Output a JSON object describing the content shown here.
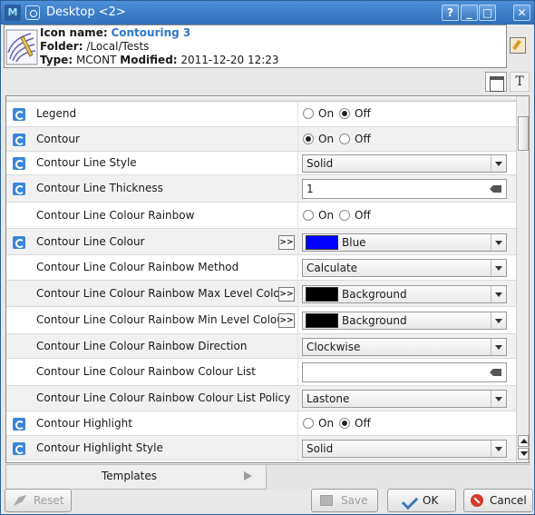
{
  "window": {
    "app_icon": "metview-icon",
    "title": "Desktop <2>",
    "controls": [
      "help-icon",
      "minimize-icon",
      "maximize-icon",
      "close-icon"
    ],
    "help_glyph": "?",
    "min_glyph": "_",
    "max_glyph": "□",
    "close_glyph": "✕"
  },
  "icon_info": {
    "name_label": "Icon name:",
    "name": "Contouring 3",
    "folder_label": "Folder:",
    "folder": "/Local/Tests",
    "type_label": "Type:",
    "type": "MCONT",
    "modified_label": "Modified:",
    "modified": "2011-12-20 12:23"
  },
  "view_buttons": {
    "text_view_glyph": "T"
  },
  "radio_labels": {
    "on": "On",
    "off": "Off"
  },
  "more_glyph": ">>",
  "rows": [
    {
      "label": "Legend",
      "has_reset": true,
      "kind": "radio",
      "value": "Off"
    },
    {
      "label": "Contour",
      "has_reset": true,
      "kind": "radio",
      "value": "On"
    },
    {
      "label": "Contour Line Style",
      "has_reset": true,
      "kind": "combo",
      "value": "Solid"
    },
    {
      "label": "Contour Line Thickness",
      "has_reset": true,
      "kind": "text",
      "value": "1"
    },
    {
      "label": "Contour Line Colour Rainbow",
      "has_reset": false,
      "kind": "radio",
      "value": "none"
    },
    {
      "label": "Contour Line Colour",
      "has_reset": true,
      "kind": "color",
      "value": "Blue",
      "swatch": "#0000ff"
    },
    {
      "label": "Contour Line Colour Rainbow Method",
      "has_reset": false,
      "kind": "combo",
      "value": "Calculate"
    },
    {
      "label": "Contour Line Colour Rainbow Max Level Colour",
      "has_reset": false,
      "kind": "color",
      "value": "Background",
      "swatch": "#000000"
    },
    {
      "label": "Contour Line Colour Rainbow Min Level Colour",
      "has_reset": false,
      "kind": "color",
      "value": "Background",
      "swatch": "#000000"
    },
    {
      "label": "Contour Line Colour Rainbow Direction",
      "has_reset": false,
      "kind": "combo",
      "value": "Clockwise"
    },
    {
      "label": "Contour Line Colour Rainbow Colour List",
      "has_reset": false,
      "kind": "text",
      "value": ""
    },
    {
      "label": "Contour Line Colour Rainbow Colour List Policy",
      "has_reset": false,
      "kind": "combo",
      "value": "Lastone"
    },
    {
      "label": "Contour Highlight",
      "has_reset": true,
      "kind": "radio",
      "value": "Off"
    },
    {
      "label": "Contour Highlight Style",
      "has_reset": true,
      "kind": "combo",
      "value": "Solid"
    }
  ],
  "tabs": {
    "templates": "Templates"
  },
  "buttons": {
    "reset": "Reset",
    "save": "Save",
    "ok": "OK",
    "cancel": "Cancel"
  }
}
